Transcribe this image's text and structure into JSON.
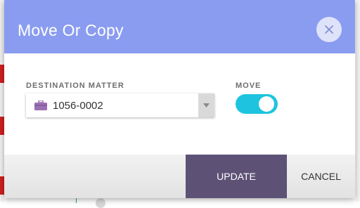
{
  "dialog": {
    "title": "Move Or Copy",
    "close_icon": "close-icon"
  },
  "destination": {
    "label": "DESTINATION MATTER",
    "value": "1056-0002",
    "icon": "briefcase-icon"
  },
  "move": {
    "label": "MOVE",
    "enabled": true
  },
  "footer": {
    "update_label": "UPDATE",
    "cancel_label": "CANCEL"
  },
  "colors": {
    "header": "#8a9cf0",
    "update_button": "#5d5276",
    "toggle_on": "#1ec4df",
    "briefcase": "#9b6fb3"
  }
}
